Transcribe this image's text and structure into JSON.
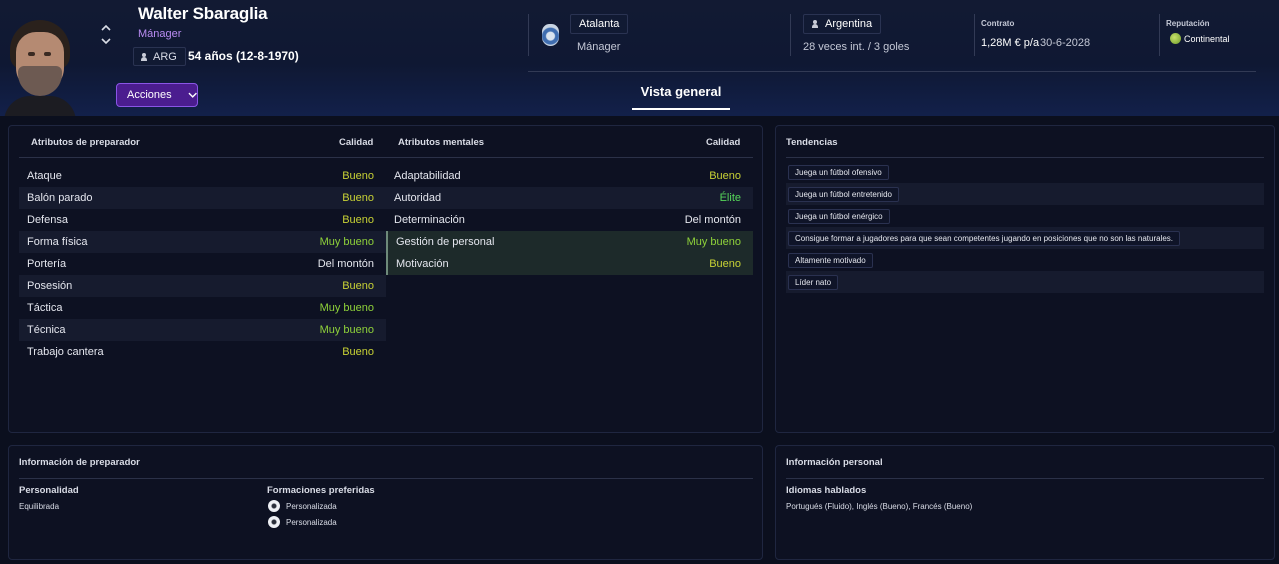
{
  "header": {
    "name": "Walter Sbaraglia",
    "role": "Mánager",
    "nation_code": "ARG",
    "age": "54 años (12-8-1970)",
    "actions_label": "Acciones",
    "club": "Atalanta",
    "club_role": "Mánager",
    "country": "Argentina",
    "caps": "28 veces int. / 3 goles",
    "contract_label": "Contrato",
    "contract_salary": "1,28M € p/a",
    "contract_end": "30-6-2028",
    "reputation_label": "Reputación",
    "reputation_value": "Continental"
  },
  "tabs": {
    "overview": "Vista general"
  },
  "coach_attributes": {
    "title": "Atributos de preparador",
    "quality_header": "Calidad",
    "rows": [
      {
        "name": "Ataque",
        "quality": "Bueno"
      },
      {
        "name": "Balón parado",
        "quality": "Bueno"
      },
      {
        "name": "Defensa",
        "quality": "Bueno"
      },
      {
        "name": "Forma física",
        "quality": "Muy bueno"
      },
      {
        "name": "Portería",
        "quality": "Del montón"
      },
      {
        "name": "Posesión",
        "quality": "Bueno"
      },
      {
        "name": "Táctica",
        "quality": "Muy bueno"
      },
      {
        "name": "Técnica",
        "quality": "Muy bueno"
      },
      {
        "name": "Trabajo cantera",
        "quality": "Bueno"
      }
    ]
  },
  "mental_attributes": {
    "title": "Atributos mentales",
    "quality_header": "Calidad",
    "rows": [
      {
        "name": "Adaptabilidad",
        "quality": "Bueno"
      },
      {
        "name": "Autoridad",
        "quality": "Élite"
      },
      {
        "name": "Determinación",
        "quality": "Del montón"
      },
      {
        "name": "Gestión de personal",
        "quality": "Muy bueno"
      },
      {
        "name": "Motivación",
        "quality": "Bueno"
      }
    ]
  },
  "tendencies": {
    "title": "Tendencias",
    "items": [
      "Juega un fútbol ofensivo",
      "Juega un fútbol entretenido",
      "Juega un fútbol enérgico",
      "Consigue formar a jugadores para que sean competentes jugando en posiciones que no son las naturales.",
      "Altamente motivado",
      "Líder nato"
    ]
  },
  "coach_info": {
    "title": "Información de preparador",
    "personality_label": "Personalidad",
    "personality_value": "Equilibrada",
    "formations_label": "Formaciones preferidas",
    "formations": [
      "Personalizada",
      "Personalizada"
    ]
  },
  "personal_info": {
    "title": "Información personal",
    "languages_label": "Idiomas hablados",
    "languages_value": "Portugués (Fluido), Inglés (Bueno), Francés (Bueno)"
  },
  "colors": {
    "accent_purple": "#8a55e6",
    "quality_bueno": "#c8d235",
    "quality_muy_bueno": "#8fd23a",
    "quality_elite": "#56d65a"
  }
}
